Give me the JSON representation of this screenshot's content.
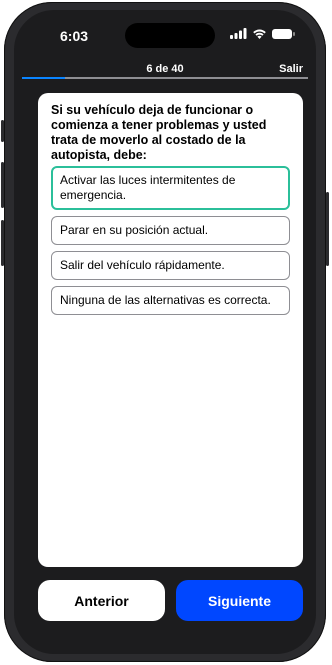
{
  "status_bar": {
    "time": "6:03"
  },
  "header": {
    "counter": "6 de 40",
    "exit_label": "Salir",
    "progress": 0.15
  },
  "question": {
    "text": "Si su vehículo deja de funcionar o comienza a tener problemas y usted trata de moverlo al costado de la autopista, debe:",
    "options": [
      "Activar las luces intermitentes de emergencia.",
      "Parar en su posición actual.",
      "Salir del vehículo rápidamente.",
      "Ninguna de las alternativas es correcta."
    ],
    "selected_index": 0
  },
  "footer": {
    "prev_label": "Anterior",
    "next_label": "Siguiente"
  },
  "colors": {
    "accent": "#0047ff",
    "selected_border": "#2bbf9a",
    "progress": "#0a84ff"
  },
  "icons": [
    "signal-icon",
    "wifi-icon",
    "battery-icon"
  ]
}
